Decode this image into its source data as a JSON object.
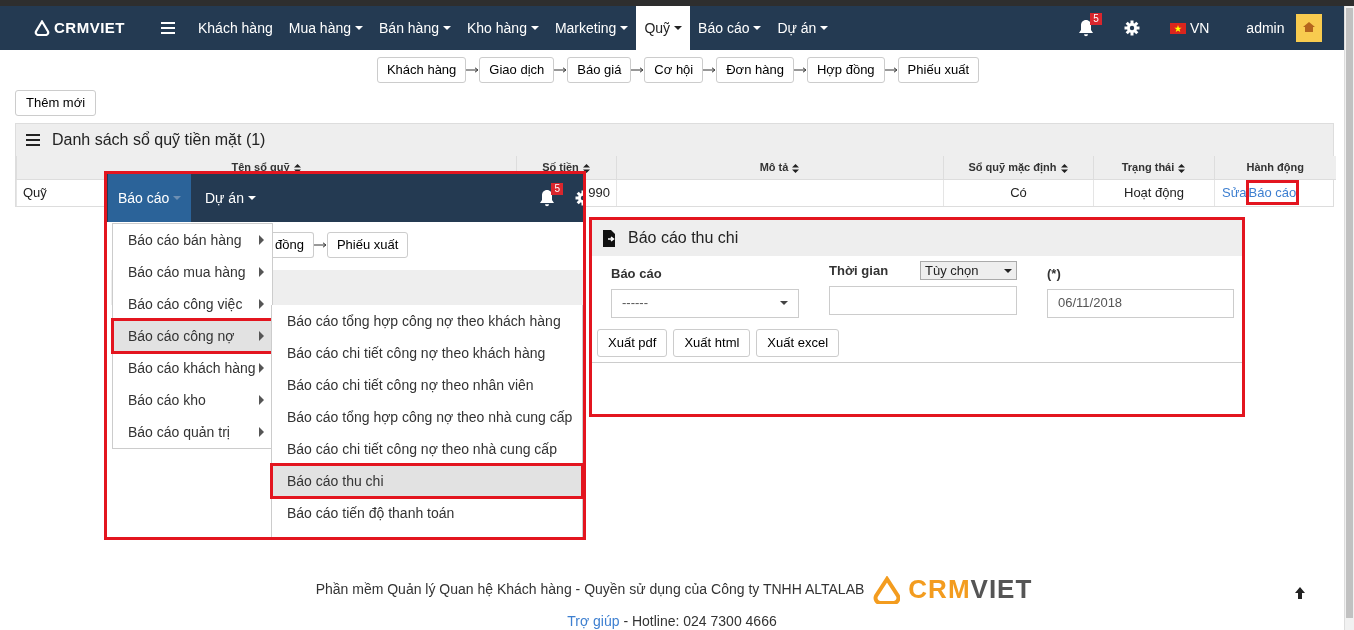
{
  "navbar": {
    "brand": "CRMVIET",
    "items": [
      {
        "label": "Khách hàng",
        "dropdown": false,
        "selected": false
      },
      {
        "label": "Mua hàng",
        "dropdown": true,
        "selected": false
      },
      {
        "label": "Bán hàng",
        "dropdown": true,
        "selected": false
      },
      {
        "label": "Kho hàng",
        "dropdown": true,
        "selected": false
      },
      {
        "label": "Marketing",
        "dropdown": true,
        "selected": false
      },
      {
        "label": "Quỹ",
        "dropdown": true,
        "selected": true
      },
      {
        "label": "Báo cáo",
        "dropdown": true,
        "selected": false
      },
      {
        "label": "Dự án",
        "dropdown": true,
        "selected": false
      }
    ],
    "notification_count": "5",
    "language": "VN",
    "user": "admin"
  },
  "workflow_steps": [
    "Khách hàng",
    "Giao dịch",
    "Báo giá",
    "Cơ hội",
    "Đơn hàng",
    "Hợp đồng",
    "Phiếu xuất"
  ],
  "add_button": "Thêm mới",
  "cash_book_list": {
    "title": "Danh sách sổ quỹ tiền mặt (1)",
    "columns": [
      {
        "label": "Tên sổ quỹ",
        "sortable": true
      },
      {
        "label": "Số tiền",
        "sortable": true
      },
      {
        "label": "Mô tả",
        "sortable": true
      },
      {
        "label": "Sổ quỹ mặc định",
        "sortable": true
      },
      {
        "label": "Trạng thái",
        "sortable": true
      },
      {
        "label": "Hành động",
        "sortable": false
      }
    ],
    "rows": [
      {
        "name": "Quỹ",
        "amount": "990",
        "default": "Có",
        "status": "Hoạt động",
        "actions": [
          {
            "label": "Sửa",
            "highlighted": false
          },
          {
            "label": "Báo cáo",
            "highlighted": true
          }
        ]
      }
    ]
  },
  "inset": {
    "highlighted": true,
    "navbar": {
      "items": [
        {
          "label": "Báo cáo",
          "selected": true
        },
        {
          "label": "Dự án",
          "selected": false
        }
      ],
      "notification_count": "5"
    },
    "background_steps": [
      "đồng",
      "Phiếu xuất"
    ],
    "menu": [
      {
        "label": "Báo cáo bán hàng",
        "selected": false,
        "highlighted": false
      },
      {
        "label": "Báo cáo mua hàng",
        "selected": false,
        "highlighted": false
      },
      {
        "label": "Báo cáo công việc",
        "selected": false,
        "highlighted": false
      },
      {
        "label": "Báo cáo công nợ",
        "selected": true,
        "highlighted": true
      },
      {
        "label": "Báo cáo khách hàng",
        "selected": false,
        "highlighted": false
      },
      {
        "label": "Báo cáo kho",
        "selected": false,
        "highlighted": false
      },
      {
        "label": "Báo cáo quản trị",
        "selected": false,
        "highlighted": false
      }
    ],
    "submenu": [
      {
        "label": "Báo cáo tổng hợp công nợ theo khách hàng",
        "selected": false,
        "highlighted": false
      },
      {
        "label": "Báo cáo chi tiết công nợ theo khách hàng",
        "selected": false,
        "highlighted": false
      },
      {
        "label": "Báo cáo chi tiết công nợ theo nhân viên",
        "selected": false,
        "highlighted": false
      },
      {
        "label": "Báo cáo tổng hợp công nợ theo nhà cung cấp",
        "selected": false,
        "highlighted": false
      },
      {
        "label": "Báo cáo chi tiết công nợ theo nhà cung cấp",
        "selected": false,
        "highlighted": false
      },
      {
        "label": "Báo cáo thu chi",
        "selected": true,
        "highlighted": true
      },
      {
        "label": "Báo cáo tiến độ thanh toán",
        "selected": false,
        "highlighted": false
      }
    ]
  },
  "report_panel": {
    "highlighted": true,
    "title": "Báo cáo thu chi",
    "report_label": "Báo cáo",
    "report_value": "------",
    "time_label": "Thời gian",
    "time_mode": "Tùy chọn",
    "date_label": "(*)",
    "date_value": "06/11/2018",
    "buttons": [
      "Xuất pdf",
      "Xuất html",
      "Xuất excel"
    ]
  },
  "footer": {
    "text": "Phần mềm Quản lý Quan hệ Khách hàng - Quyền sử dụng của Công ty TNHH ALTALAB",
    "brand_accent": "CRM",
    "brand_rest": "VIET",
    "help_link": "Trợ giúp",
    "hotline": "- Hotline: 024 7300 4666"
  }
}
